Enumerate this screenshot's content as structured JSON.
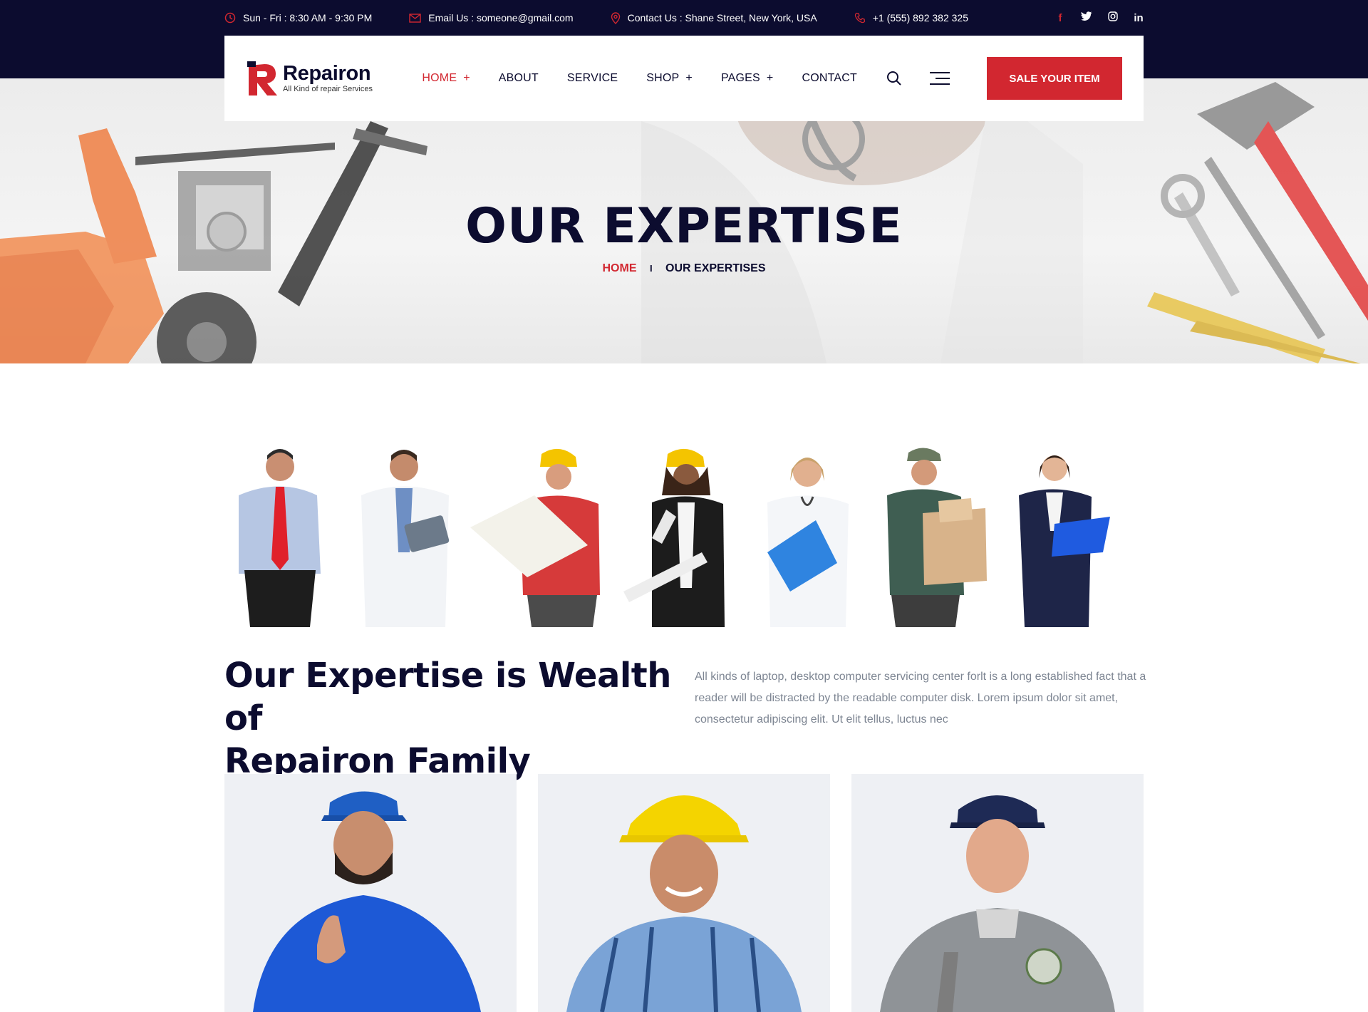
{
  "topbar": {
    "hours": "Sun - Fri : 8:30 AM - 9:30 PM",
    "email": "Email Us : someone@gmail.com",
    "address": "Contact Us : Shane Street, New York, USA",
    "phone": "+1 (555) 892 382 325",
    "socials": [
      {
        "icon": "facebook-icon",
        "glyph": "f"
      },
      {
        "icon": "twitter-icon",
        "glyph": "t"
      },
      {
        "icon": "instagram-icon",
        "glyph": "◎"
      },
      {
        "icon": "linkedin-icon",
        "glyph": "in"
      }
    ]
  },
  "header": {
    "logo_name": "Repairon",
    "logo_tag": "All Kind of repair Services",
    "nav": [
      {
        "label": "HOME",
        "plus": "+"
      },
      {
        "label": "ABOUT",
        "plus": ""
      },
      {
        "label": "SERVICE",
        "plus": ""
      },
      {
        "label": "SHOP",
        "plus": "+"
      },
      {
        "label": "PAGES",
        "plus": "+"
      },
      {
        "label": "CONTACT",
        "plus": ""
      }
    ],
    "cta": "SALE YOUR ITEM"
  },
  "hero": {
    "title": "OUR EXPERTISE",
    "breadcrumb_home": "HOME",
    "breadcrumb_sep": "I",
    "breadcrumb_current": "OUR EXPERTISES"
  },
  "expertise": {
    "title_line1": "Our Expertise is Wealth of",
    "title_line2": "Repairon Family",
    "text": "All kinds of laptop, desktop computer servicing center forlt is a long established fact that a reader will be distracted by the readable computer disk. Lorem ipsum dolor sit amet, consectetur adipiscing elit. Ut elit tellus, luctus nec"
  },
  "colors": {
    "brand_red": "#d22730",
    "navy": "#0c0c2f",
    "text_gray": "#7d8592"
  }
}
